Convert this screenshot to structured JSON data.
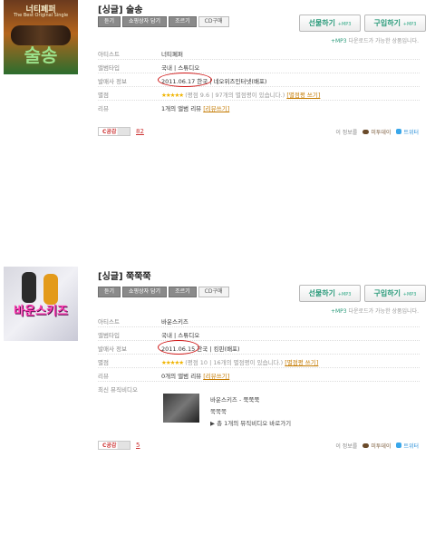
{
  "albums": [
    {
      "cover": {
        "line1": "너티페퍼",
        "line2": "The Best Original Single",
        "line3": "술송"
      },
      "title": "[싱글] 술송",
      "tabs": [
        "듣기",
        "쇼핑상자 담기",
        "조르기",
        "CD구매"
      ],
      "gift_label": "선물하기",
      "buy_label": "구입하기",
      "mp3_tag": "+MP3",
      "note_prefix": "+MP3",
      "note_text": " 다운로드가 가능한 상품입니다.",
      "rows": {
        "artist_key": "아티스트",
        "artist_val": "너티페퍼",
        "type_key": "앨범타입",
        "type_val": "국내 | 스튜디오",
        "release_key": "발매사 정보",
        "release_date": "2011.06.17",
        "release_rest": " 한국 | 네오위즈인터넷(배포)",
        "rating_key": "별점",
        "rating_stars": "★★★★★",
        "rating_text": "(평점 9.6 | 97개의 별점평이 있습니다.)",
        "rating_link": "[별점평 쓰기]",
        "review_key": "리뷰",
        "review_text": "1개의 앨범 리뷰",
        "review_link": "[리뷰쓰기]"
      },
      "cbutton": "C공감",
      "count": "82",
      "share_info": "이 정보를",
      "me2": "미투데이",
      "twitter": "트위터"
    },
    {
      "cover": {
        "line1": "바운스키즈"
      },
      "title": "[싱글] 쭉쭉쭉",
      "tabs": [
        "듣기",
        "쇼핑상자 담기",
        "조르기",
        "CD구매"
      ],
      "gift_label": "선물하기",
      "buy_label": "구입하기",
      "mp3_tag": "+MP3",
      "note_prefix": "+MP3",
      "note_text": " 다운로드가 가능한 상품입니다.",
      "rows": {
        "artist_key": "아티스트",
        "artist_val": "바운스키즈",
        "type_key": "앨범타입",
        "type_val": "국내 | 스튜디오",
        "release_key": "발매사 정보",
        "release_date": "2011.06.15",
        "release_rest": " 한국 | 킹핀(배포)",
        "rating_key": "별점",
        "rating_stars": "★★★★★",
        "rating_text": "(평점 10 | 16개의 별점평이 있습니다.)",
        "rating_link": "[별점평 쓰기]",
        "review_key": "리뷰",
        "review_text": "0개의 앨범 리뷰",
        "review_link": "[리뷰쓰기]",
        "mv_key": "최신 뮤직비디오"
      },
      "mv": {
        "artist_title": "바운스키즈 - 쭉쭉쭉",
        "song": "쭉쭉쭉",
        "more": "▶ 총 1개의 뮤직비디오 바로가기"
      },
      "cbutton": "C공감",
      "count": "5",
      "share_info": "이 정보를",
      "me2": "미투데이",
      "twitter": "트위터"
    }
  ]
}
